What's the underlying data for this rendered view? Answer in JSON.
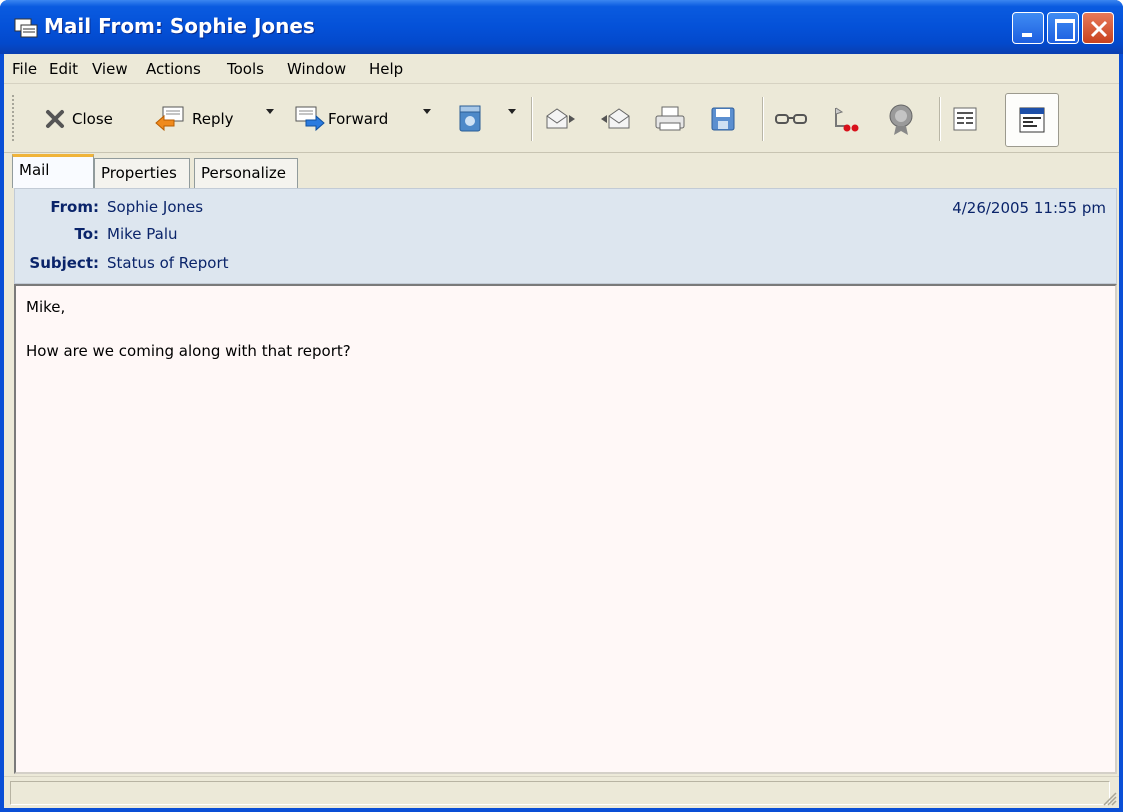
{
  "window": {
    "title": "Mail From: Sophie Jones",
    "colors": {
      "titlebar": "#0451d8",
      "close_button": "#c8421e",
      "header_panel": "#dde6ef",
      "body_bg": "#fff8f7",
      "active_tab_accent": "#f0b43a"
    }
  },
  "menu": {
    "items": [
      "File",
      "Edit",
      "View",
      "Actions",
      "Tools",
      "Window",
      "Help"
    ]
  },
  "toolbar": {
    "close_label": "Close",
    "reply_label": "Reply",
    "forward_label": "Forward",
    "icons": [
      "close-icon",
      "reply-icon",
      "forward-icon",
      "move-to-folder-icon",
      "next-item-icon",
      "previous-item-icon",
      "print-icon",
      "save-icon",
      "read-glasses-icon",
      "priority-flag-icon",
      "seal-icon",
      "view-details-icon",
      "view-message-icon"
    ]
  },
  "tabs": [
    "Mail",
    "Properties",
    "Personalize"
  ],
  "message": {
    "from_label": "From:",
    "from": "Sophie Jones",
    "to_label": "To:",
    "to": "Mike Palu",
    "subject_label": "Subject:",
    "subject": "Status of Report",
    "date": "4/26/2005 11:55 pm",
    "body": [
      "Mike,",
      "How are we coming along with that report?"
    ]
  }
}
